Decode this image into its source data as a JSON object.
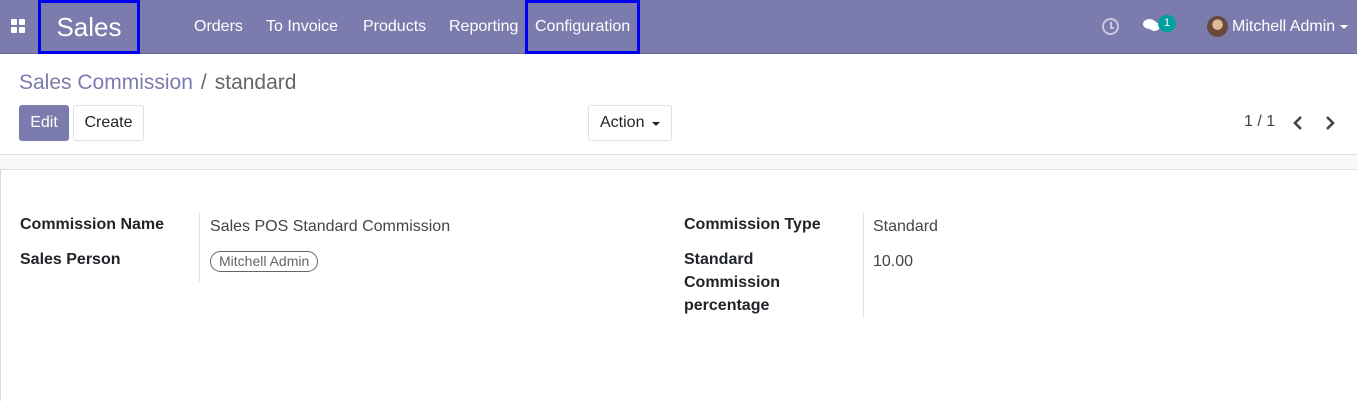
{
  "navbar": {
    "brand": "Sales",
    "menu": [
      "Orders",
      "To Invoice",
      "Products",
      "Reporting",
      "Configuration"
    ],
    "chat_count": "1",
    "user_name": "Mitchell Admin",
    "icons": [
      "apps-icon",
      "clock-icon",
      "chat-icon",
      "avatar",
      "caret-down-icon"
    ]
  },
  "breadcrumb": {
    "parent": "Sales Commission",
    "separator": "/",
    "current": "standard"
  },
  "buttons": {
    "edit": "Edit",
    "create": "Create",
    "action": "Action"
  },
  "pager": {
    "value": "1 / 1"
  },
  "form": {
    "left": {
      "commission_name_label": "Commission Name",
      "commission_name_value": "Sales POS Standard Commission",
      "sales_person_label": "Sales Person",
      "sales_person_value": "Mitchell Admin"
    },
    "right": {
      "commission_type_label": "Commission Type",
      "commission_type_value": "Standard",
      "percentage_label_1": "Standard",
      "percentage_label_2": "Commission",
      "percentage_label_3": "percentage",
      "percentage_value": "10.00"
    }
  },
  "colors": {
    "navbar": "#7c7bad",
    "highlight_box": "#0000ee",
    "badge": "#00a09d"
  }
}
